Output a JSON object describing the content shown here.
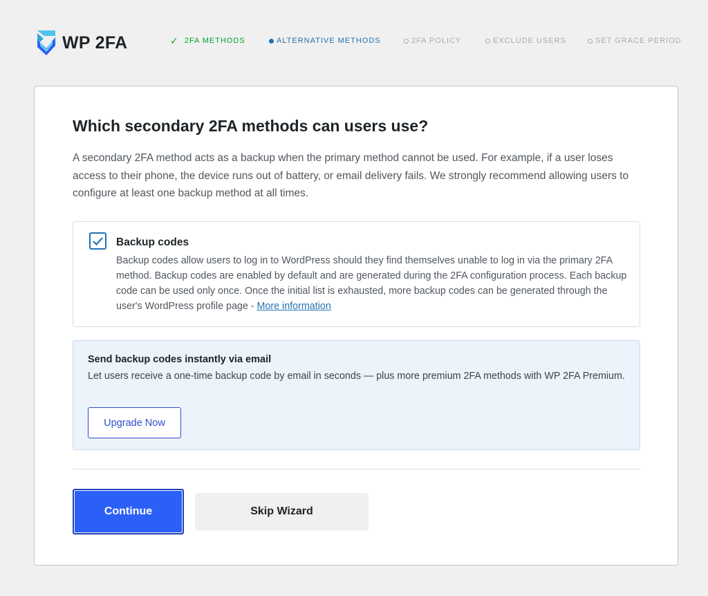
{
  "logo": {
    "text": "WP 2FA",
    "icon": "wp2fa-logo-icon"
  },
  "steps": [
    {
      "label": "2FA METHODS",
      "state": "done",
      "icon": "check-icon"
    },
    {
      "label": "ALTERNATIVE METHODS",
      "state": "active"
    },
    {
      "label": "2FA POLICY",
      "state": "todo"
    },
    {
      "label": "EXCLUDE USERS",
      "state": "todo"
    },
    {
      "label": "SET GRACE PERIOD",
      "state": "todo"
    }
  ],
  "main": {
    "title": "Which secondary 2FA methods can users use?",
    "intro": "A secondary 2FA method acts as a backup when the primary method cannot be used. For example, if a user loses access to their phone, the device runs out of battery, or email delivery fails. We strongly recommend allowing users to configure at least one backup method at all times."
  },
  "option": {
    "checked": true,
    "title": "Backup codes",
    "description": "Backup codes allow users to log in to WordPress should they find themselves unable to log in via the primary 2FA method. Backup codes are enabled by default and are generated during the 2FA configuration process. Each backup code can be used only once. Once the initial list is exhausted, more backup codes can be generated through the user's WordPress profile page - ",
    "link_label": "More information"
  },
  "promo": {
    "title": "Send backup codes instantly via email",
    "description": "Let users receive a one-time backup code by email in seconds — plus more premium 2FA methods with WP 2FA Premium.",
    "button_label": "Upgrade Now"
  },
  "footer": {
    "continue_label": "Continue",
    "skip_label": "Skip Wizard"
  },
  "colors": {
    "done": "#00a32a",
    "active": "#2271b1",
    "todo": "#a7aaad",
    "primary_button": "#2c5ff6",
    "promo_bg": "#edf3fb"
  }
}
